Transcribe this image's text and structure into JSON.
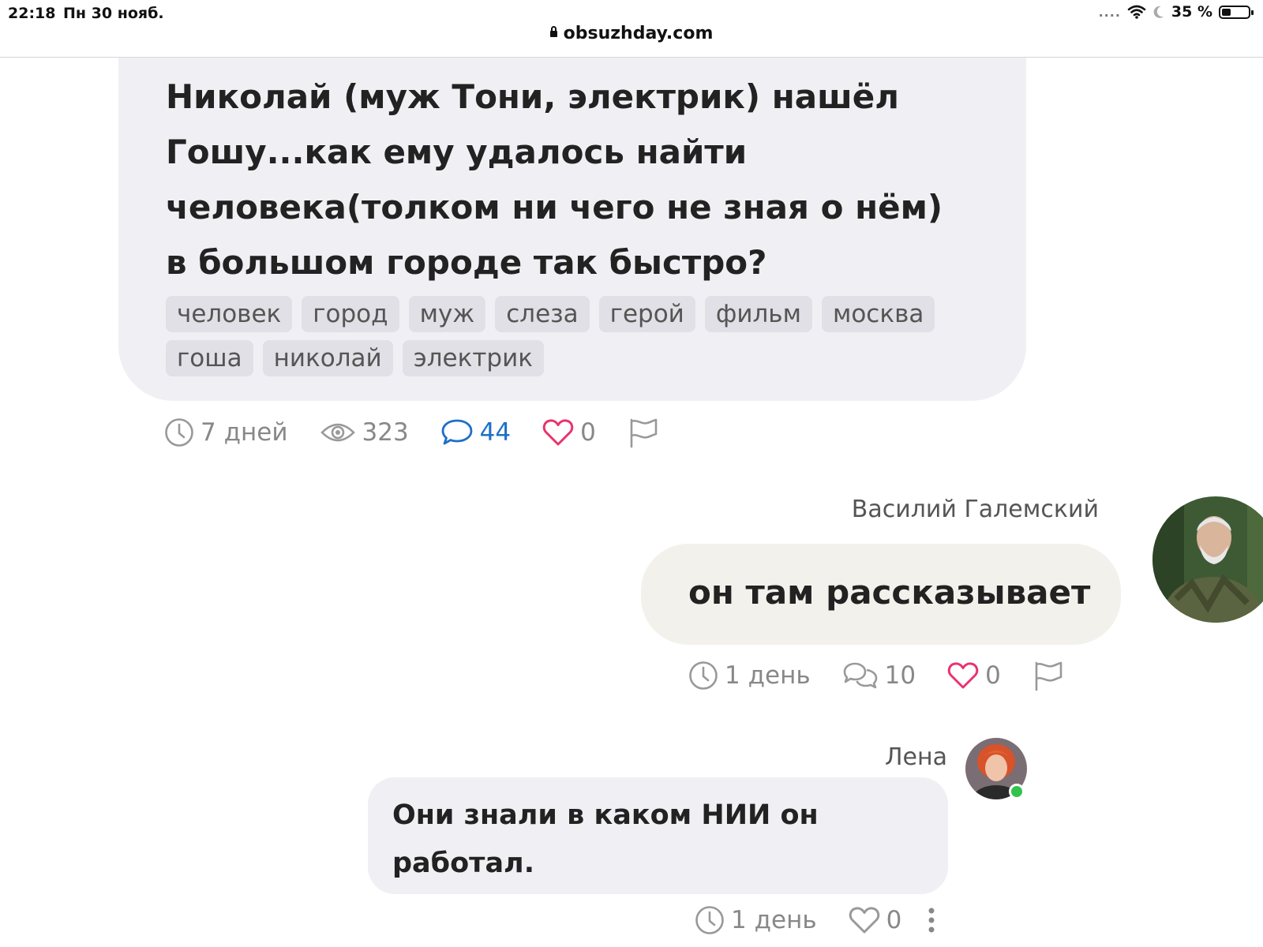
{
  "status_bar": {
    "time": "22:18",
    "date": "Пн 30 нояб.",
    "signal": "....",
    "battery_text": "35 %",
    "battery_level": 0.35
  },
  "browser": {
    "url": "obsuzhday.com"
  },
  "post": {
    "text": "Николай (муж Тони, электрик) нашёл Гошу...как ему удалось найти человека(толком ни чего не зная о нём) в большом городе так быстро?",
    "tags": [
      "человек",
      "город",
      "муж",
      "слеза",
      "герой",
      "фильм",
      "москва",
      "гоша",
      "николай",
      "электрик"
    ],
    "meta": {
      "age": "7 дней",
      "views": "323",
      "comments": "44",
      "likes": "0"
    }
  },
  "comments": [
    {
      "author": "Василий Галемский",
      "text": "он там рассказывает",
      "meta": {
        "age": "1 день",
        "replies": "10",
        "likes": "0"
      }
    },
    {
      "author": "Лена",
      "text": "Они знали в каком НИИ он работал.",
      "meta": {
        "age": "1 день",
        "likes": "0"
      }
    }
  ],
  "colors": {
    "accent_blue": "#1e6fc7",
    "heart_pink": "#e8336d",
    "online_green": "#33c24d",
    "card_gray": "#f0f0f4",
    "bubble_beige": "#f3f1ec"
  },
  "icons": [
    "lock-icon",
    "wifi-icon",
    "moon-icon",
    "battery-icon",
    "clock-icon",
    "eye-icon",
    "comment-icon",
    "heart-icon",
    "flag-icon",
    "replies-icon",
    "more-icon"
  ]
}
